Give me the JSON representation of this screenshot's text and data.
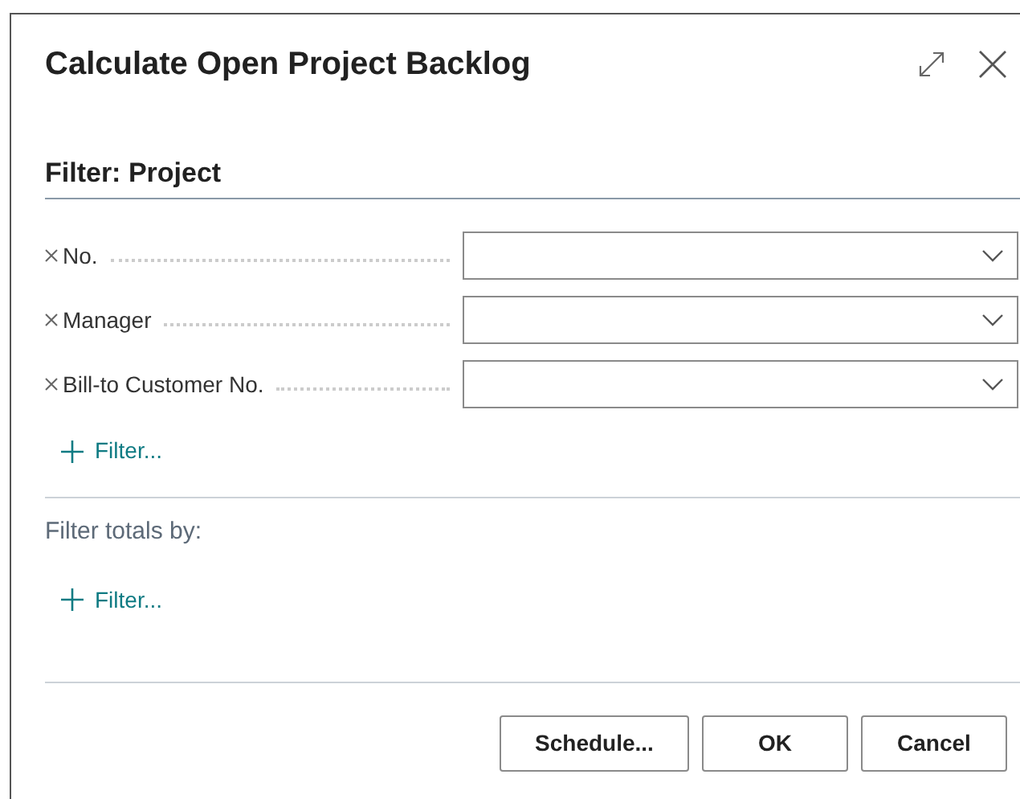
{
  "dialog": {
    "title": "Calculate Open Project Backlog"
  },
  "filter_section": {
    "heading": "Filter: Project",
    "fields": [
      {
        "label": "No."
      },
      {
        "label": "Manager"
      },
      {
        "label": "Bill-to Customer No."
      }
    ],
    "add_filter": "Filter..."
  },
  "totals_section": {
    "heading": "Filter totals by:",
    "add_filter": "Filter..."
  },
  "buttons": [
    "Schedule...",
    "OK",
    "Cancel"
  ]
}
